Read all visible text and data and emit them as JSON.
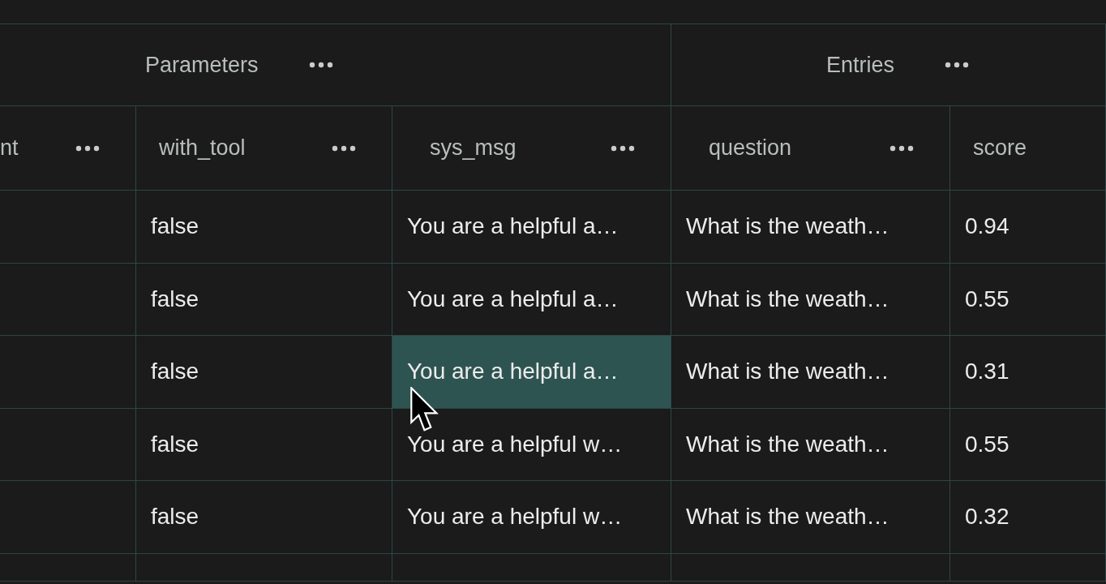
{
  "column_groups": [
    {
      "label": "Parameters"
    },
    {
      "label": "Entries"
    }
  ],
  "columns": [
    {
      "label": "nt",
      "menu": true
    },
    {
      "label": "with_tool",
      "menu": true
    },
    {
      "label": "sys_msg",
      "menu": true
    },
    {
      "label": "question",
      "menu": true
    },
    {
      "label": "score",
      "menu": false
    }
  ],
  "rows": [
    {
      "cells": [
        {
          "text": "false",
          "selected": false
        },
        {
          "text": "You are a helpful a…",
          "selected": false
        },
        {
          "text": "What is the weath…",
          "selected": false
        },
        {
          "text": "0.94",
          "selected": false
        }
      ]
    },
    {
      "cells": [
        {
          "text": "false",
          "selected": false
        },
        {
          "text": "You are a helpful a…",
          "selected": false
        },
        {
          "text": "What is the weath…",
          "selected": false
        },
        {
          "text": "0.55",
          "selected": false
        }
      ]
    },
    {
      "cells": [
        {
          "text": "false",
          "selected": false
        },
        {
          "text": "You are a helpful a…",
          "selected": true
        },
        {
          "text": "What is the weath…",
          "selected": false
        },
        {
          "text": "0.31",
          "selected": false
        }
      ]
    },
    {
      "cells": [
        {
          "text": "false",
          "selected": false
        },
        {
          "text": "You are a helpful w…",
          "selected": false
        },
        {
          "text": "What is the weath…",
          "selected": false
        },
        {
          "text": "0.55",
          "selected": false
        }
      ]
    },
    {
      "cells": [
        {
          "text": "false",
          "selected": false
        },
        {
          "text": "You are a helpful w…",
          "selected": false
        },
        {
          "text": "What is the weath…",
          "selected": false
        },
        {
          "text": "0.32",
          "selected": false
        }
      ]
    }
  ]
}
